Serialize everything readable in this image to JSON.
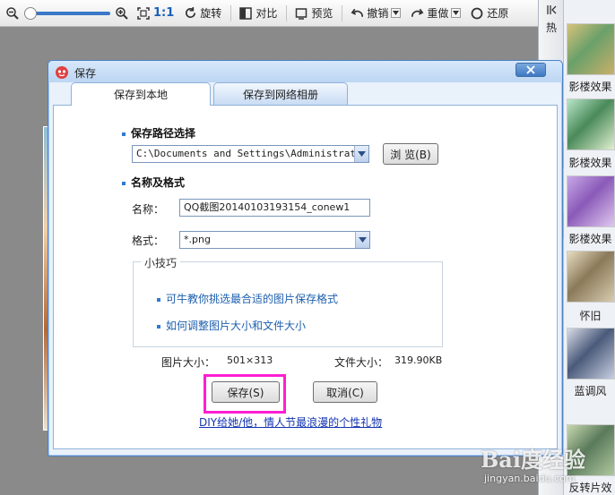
{
  "toolbar": {
    "zoom_ratio": "1:1",
    "rotate": "旋转",
    "compare": "对比",
    "preview": "预览",
    "undo": "撤销",
    "redo": "重做",
    "restore": "还原"
  },
  "zoom": {
    "slider_fraction": 0.0
  },
  "right_panel": {
    "hot_tab": "热",
    "thumbnails": [
      {
        "label": "影楼效果"
      },
      {
        "label": "影楼效果"
      },
      {
        "label": "影楼效果"
      },
      {
        "label": "怀旧"
      },
      {
        "label": "蓝调风"
      },
      {
        "label": "反转片效"
      }
    ]
  },
  "dialog": {
    "title": "保存",
    "tabs": [
      "保存到本地",
      "保存到网络相册"
    ],
    "path_section_title": "保存路径选择",
    "path_value": "C:\\Documents and Settings\\Administrator\\桌面",
    "browse_button": "浏 览(B)",
    "name_section_title": "名称及格式",
    "name_label": "名称：",
    "name_value": "QQ截图20140103193154_conew1",
    "format_label": "格式：",
    "format_value": "*.png",
    "tips_title": "小技巧",
    "tips": [
      "可牛教你挑选最合适的图片保存格式",
      "如何调整图片大小和文件大小"
    ],
    "image_size_label": "图片大小：",
    "image_size_value": "501×313",
    "file_size_label": "文件大小：",
    "file_size_value": "319.90KB",
    "save_button": "保存(S)",
    "cancel_button": "取消(C)",
    "promo_link": "DIY给她/他，情人节最浪漫的个性礼物"
  },
  "watermark": {
    "brand": "Bai度经验",
    "url": "jingyan.baidu.com"
  },
  "colors": {
    "accent": "#2f7bd3",
    "highlight": "#ff1ed2",
    "link": "#1d5fae"
  }
}
